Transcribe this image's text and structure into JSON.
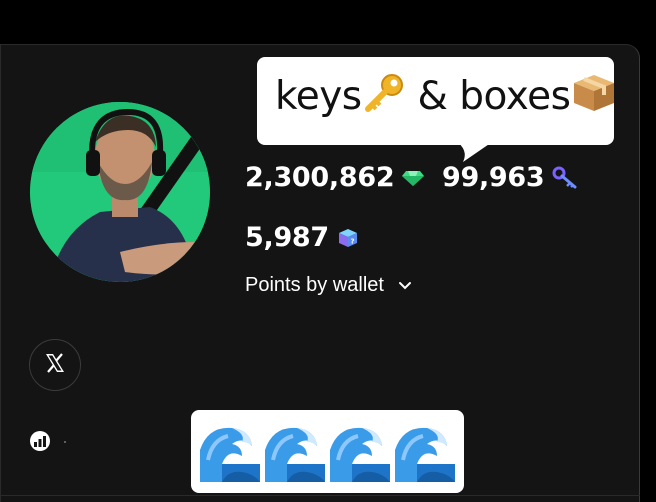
{
  "profile": {
    "avatar_alt": "profile photo"
  },
  "callout": {
    "text_keys": "keys",
    "text_and_boxes": " & boxes"
  },
  "stats": {
    "points": "2,300,862",
    "keys": "99,963",
    "boxes": "5,987"
  },
  "wallet_toggle": {
    "label": "Points by wallet"
  },
  "icons": {
    "points": "green-gem-icon",
    "keys": "purple-key-icon",
    "boxes": "mystery-box-icon",
    "callout_key": "gold-key-emoji",
    "callout_box": "package-emoji",
    "social": "x-logo-icon",
    "stats_link": "chart-icon",
    "waves": "water-wave-emoji"
  },
  "colors": {
    "background": "#000000",
    "card": "#141414",
    "avatar_bg": "#21c77a",
    "gem": "#3ddc84",
    "text": "#ffffff"
  }
}
